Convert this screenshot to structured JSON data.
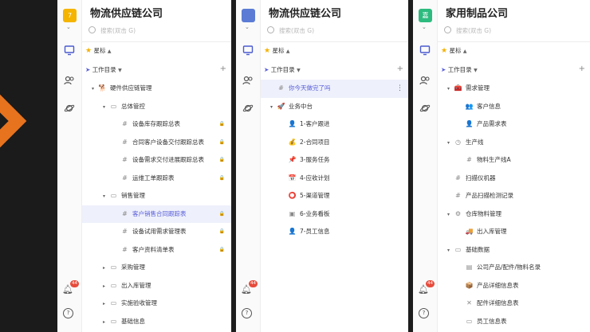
{
  "colors": {
    "orange": "#e8731e",
    "yellow_logo": "#f4b400",
    "green_logo": "#2dbb7f",
    "selected_text": "#5a5fd8",
    "badge": "#e74c3c"
  },
  "panels": [
    {
      "title": "物流供应链公司",
      "logo_text": "7",
      "search_placeholder": "搜索(双击 G)",
      "star_label": "星标",
      "workspace_label": "工作目录",
      "badge": "44",
      "items": [
        {
          "label": "硬件供应链管理",
          "icon": "pet-icon",
          "indent": 0,
          "arrow": "down"
        },
        {
          "label": "总体管控",
          "icon": "folder-icon",
          "indent": 1,
          "arrow": "down"
        },
        {
          "label": "设备库存跟踪总表",
          "icon": "table-icon",
          "indent": 2
        },
        {
          "label": "合同客户设备交付跟踪总表",
          "icon": "table-icon",
          "indent": 2
        },
        {
          "label": "设备需求交付进展跟踪总表",
          "icon": "table-icon",
          "indent": 2
        },
        {
          "label": "运维工单跟踪表",
          "icon": "table-icon",
          "indent": 2
        },
        {
          "label": "销售管理",
          "icon": "folder-icon",
          "indent": 1,
          "arrow": "down"
        },
        {
          "label": "客户销售合同跟踪表",
          "icon": "table-icon",
          "indent": 2,
          "selected": true
        },
        {
          "label": "设备试用需求管理表",
          "icon": "table-icon",
          "indent": 2
        },
        {
          "label": "客户资料清单表",
          "icon": "table-icon",
          "indent": 2
        },
        {
          "label": "采购管理",
          "icon": "folder-icon",
          "indent": 1,
          "arrow": "right"
        },
        {
          "label": "出入库管理",
          "icon": "folder-icon",
          "indent": 1,
          "arrow": "right"
        },
        {
          "label": "实施验收管理",
          "icon": "folder-icon",
          "indent": 1,
          "arrow": "right"
        },
        {
          "label": "基础信息",
          "icon": "folder-icon",
          "indent": 1,
          "arrow": "right"
        }
      ]
    },
    {
      "title": "物流供应链公司",
      "logo_text": "",
      "search_placeholder": "搜索(双击 G)",
      "star_label": "星标",
      "workspace_label": "工作目录",
      "badge": "44",
      "items": [
        {
          "label": "你今天做完了吗",
          "icon": "table-icon",
          "indent": 0,
          "selected": true
        },
        {
          "label": "业务中台",
          "icon": "rocket-icon",
          "indent": 0,
          "arrow": "down"
        },
        {
          "label": "1-客户跟进",
          "icon": "person-icon",
          "indent": 1
        },
        {
          "label": "2-合同项目",
          "icon": "moneybag-icon",
          "indent": 1
        },
        {
          "label": "3-服务任务",
          "icon": "pin-icon",
          "indent": 1
        },
        {
          "label": "4-应收计划",
          "icon": "calendar-icon",
          "indent": 1
        },
        {
          "label": "5-渠道管理",
          "icon": "ring-icon",
          "indent": 1
        },
        {
          "label": "6-业务看板",
          "icon": "monitor-icon",
          "indent": 1
        },
        {
          "label": "7-员工信息",
          "icon": "person-icon",
          "indent": 1
        }
      ]
    },
    {
      "title": "家用制品公司",
      "logo_text": "嘉",
      "search_placeholder": "搜索(双击 G)",
      "star_label": "星标",
      "workspace_label": "工作目录",
      "badge": "44",
      "items": [
        {
          "label": "需求管理",
          "icon": "toolbox-icon",
          "indent": 0,
          "arrow": "down"
        },
        {
          "label": "客户信息",
          "icon": "people-icon",
          "indent": 1
        },
        {
          "label": "产品需求表",
          "icon": "person-icon",
          "indent": 1
        },
        {
          "label": "生产线",
          "icon": "clock-icon",
          "indent": 0,
          "arrow": "down"
        },
        {
          "label": "物料生产线A",
          "icon": "table-icon",
          "indent": 1
        },
        {
          "label": "扫描仪机器",
          "icon": "table-icon",
          "indent": 0
        },
        {
          "label": "产品扫描检测记录",
          "icon": "table-icon",
          "indent": 0
        },
        {
          "label": "仓库物料管理",
          "icon": "crane-icon",
          "indent": 0,
          "arrow": "down"
        },
        {
          "label": "出入库管理",
          "icon": "truck-icon",
          "indent": 1
        },
        {
          "label": "基础数据",
          "icon": "folder-icon",
          "indent": 0,
          "arrow": "down"
        },
        {
          "label": "公司产品/配件/物料名录",
          "icon": "document-icon",
          "indent": 1
        },
        {
          "label": "产品详细信息表",
          "icon": "package-icon",
          "indent": 1
        },
        {
          "label": "配件详细信息表",
          "icon": "tools-icon",
          "indent": 1
        },
        {
          "label": "员工信息表",
          "icon": "folder-icon",
          "indent": 1
        }
      ]
    }
  ]
}
